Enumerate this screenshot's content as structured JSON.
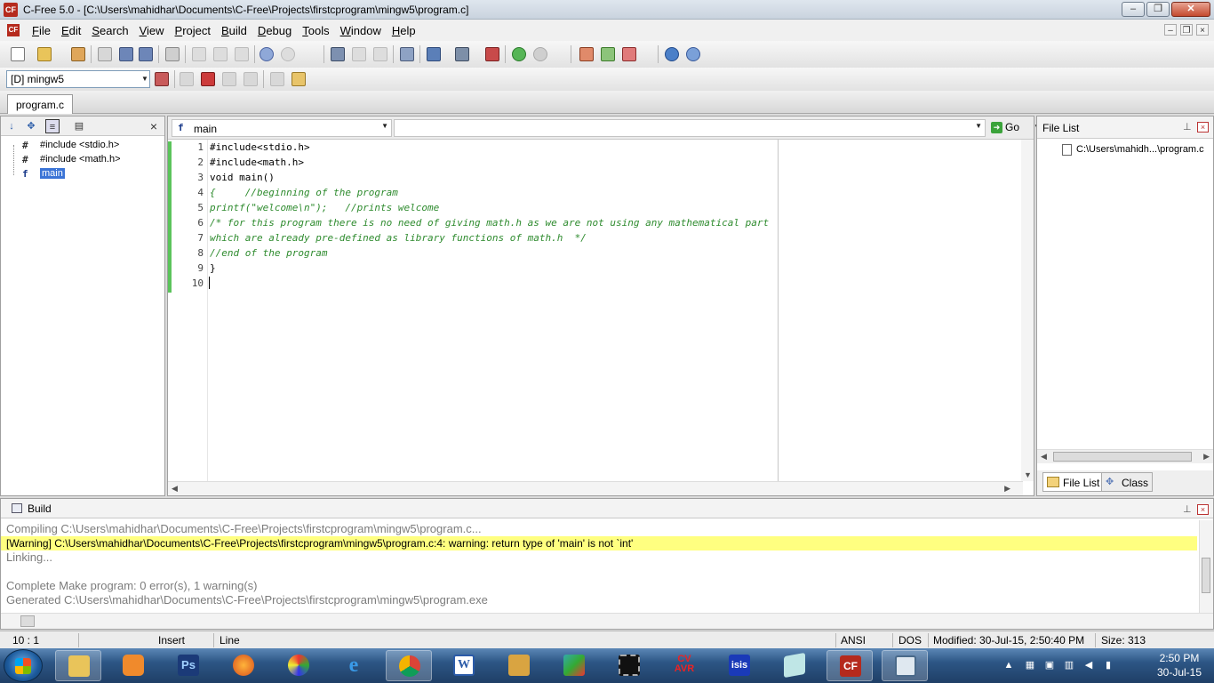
{
  "window": {
    "title": "C-Free 5.0 - [C:\\Users\\mahidhar\\Documents\\C-Free\\Projects\\firstcprogram\\mingw5\\program.c]",
    "app_icon": "CF",
    "minimize": "–",
    "restore": "❐",
    "close": "✕"
  },
  "menubar": {
    "items": [
      "File",
      "Edit",
      "Search",
      "View",
      "Project",
      "Build",
      "Debug",
      "Tools",
      "Window",
      "Help"
    ],
    "mdi_minimize": "–",
    "mdi_restore": "❐",
    "mdi_close": "×"
  },
  "toolbar": {
    "compiler": "[D] mingw5"
  },
  "tabs": {
    "open_file": "program.c"
  },
  "class_panel": {
    "close": "×",
    "tree": [
      {
        "glyph": "#",
        "label": "#include <stdio.h>"
      },
      {
        "glyph": "#",
        "label": "#include <math.h>"
      },
      {
        "glyph": "f",
        "label": "main"
      }
    ]
  },
  "editor": {
    "function_select": "main",
    "go_label": "Go",
    "line_numbers": [
      "1",
      "2",
      "3",
      "4",
      "5",
      "6",
      "7",
      "8",
      "9",
      "10"
    ],
    "lines": [
      "#include<stdio.h>",
      "#include<math.h>",
      "void main()",
      "{     //beginning of the program",
      "printf(\"welcome\\n\");   //prints welcome",
      "/* for this program there is no need of giving math.h as we are not using any mathematical part",
      "which are already pre-defined as library functions of math.h  */",
      "//end of the program",
      "}",
      ""
    ]
  },
  "file_list": {
    "title": "File List",
    "items": [
      "C:\\Users\\mahidh...\\program.c"
    ],
    "tab_file_list": "File List",
    "tab_class": "Class"
  },
  "build": {
    "title": "Build",
    "lines": [
      "Compiling C:\\Users\\mahidhar\\Documents\\C-Free\\Projects\\firstcprogram\\mingw5\\program.c...",
      "[Warning] C:\\Users\\mahidhar\\Documents\\C-Free\\Projects\\firstcprogram\\mingw5\\program.c:4: warning: return type of 'main' is not `int'",
      "Linking...",
      "",
      "Complete Make program: 0 error(s), 1 warning(s)",
      "Generated C:\\Users\\mahidhar\\Documents\\C-Free\\Projects\\firstcprogram\\mingw5\\program.exe"
    ]
  },
  "statusbar": {
    "position": "10 :  1",
    "mode": "Insert",
    "select_mode": "Line",
    "encoding": "ANSI",
    "line_ending": "DOS",
    "modified": "Modified: 30-Jul-15, 2:50:40 PM",
    "size": "Size: 313"
  },
  "taskbar": {
    "apps": [
      "explorer-icon",
      "media-player-icon",
      "photoshop-icon",
      "firefox-icon",
      "paint-icon",
      "internet-explorer-icon",
      "chrome-icon",
      "word-icon",
      "book-icon",
      "pencil-icon",
      "chip-icon",
      "cvavr-icon",
      "isis-icon",
      "notes-icon",
      "c-free-icon",
      "window-icon"
    ],
    "app_text": {
      "photoshop": "Ps",
      "cvavr": "CV\nAVR",
      "isis": "isis",
      "cfree": "CF"
    },
    "time": "2:50 PM",
    "date": "30-Jul-15"
  },
  "colors": {
    "comment": "#2e8b2e",
    "warning_bg": "#ffff80",
    "gutter_mark": "#5bc35b"
  }
}
